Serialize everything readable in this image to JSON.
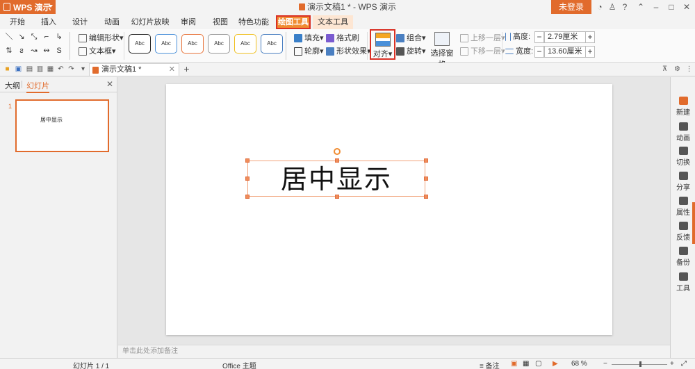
{
  "app": {
    "name": "WPS 演示",
    "window_title": "演示文稿1 * - WPS 演示",
    "login_label": "未登录"
  },
  "menu": {
    "tabs": [
      "开始",
      "插入",
      "设计",
      "动画",
      "幻灯片放映",
      "审阅",
      "视图",
      "特色功能",
      "绘图工具",
      "文本工具"
    ],
    "active": "绘图工具"
  },
  "ribbon": {
    "edit_shape": "编辑形状",
    "text_box": "文本框",
    "style_sample": "Abc",
    "fill": "填充",
    "format_painter": "格式刷",
    "outline": "轮廓",
    "shape_effects": "形状效果",
    "align": "对齐",
    "group": "组合",
    "rotate": "旋转",
    "selection_pane": "选择窗格",
    "bring_forward": "上移一层",
    "send_backward": "下移一层",
    "height_label": "高度:",
    "height_value": "2.79厘米",
    "width_label": "宽度:",
    "width_value": "13.60厘米"
  },
  "document_tab": {
    "name": "演示文稿1 *"
  },
  "left_panel": {
    "tab_outline": "大纲",
    "tab_slides": "幻灯片",
    "thumb_number": "1",
    "thumb_text": "居中显示"
  },
  "slide": {
    "text": "居中显示"
  },
  "notes_placeholder": "单击此处添加备注",
  "right_sidebar": [
    "新建",
    "动画",
    "切换",
    "分享",
    "属性",
    "反馈",
    "备份",
    "工具"
  ],
  "status": {
    "slide_counter": "幻灯片 1 / 1",
    "theme": "Office 主题",
    "notes_label": "备注",
    "zoom": "68 %"
  },
  "colors": {
    "accent": "#e16b2c",
    "highlight": "#d93025"
  }
}
